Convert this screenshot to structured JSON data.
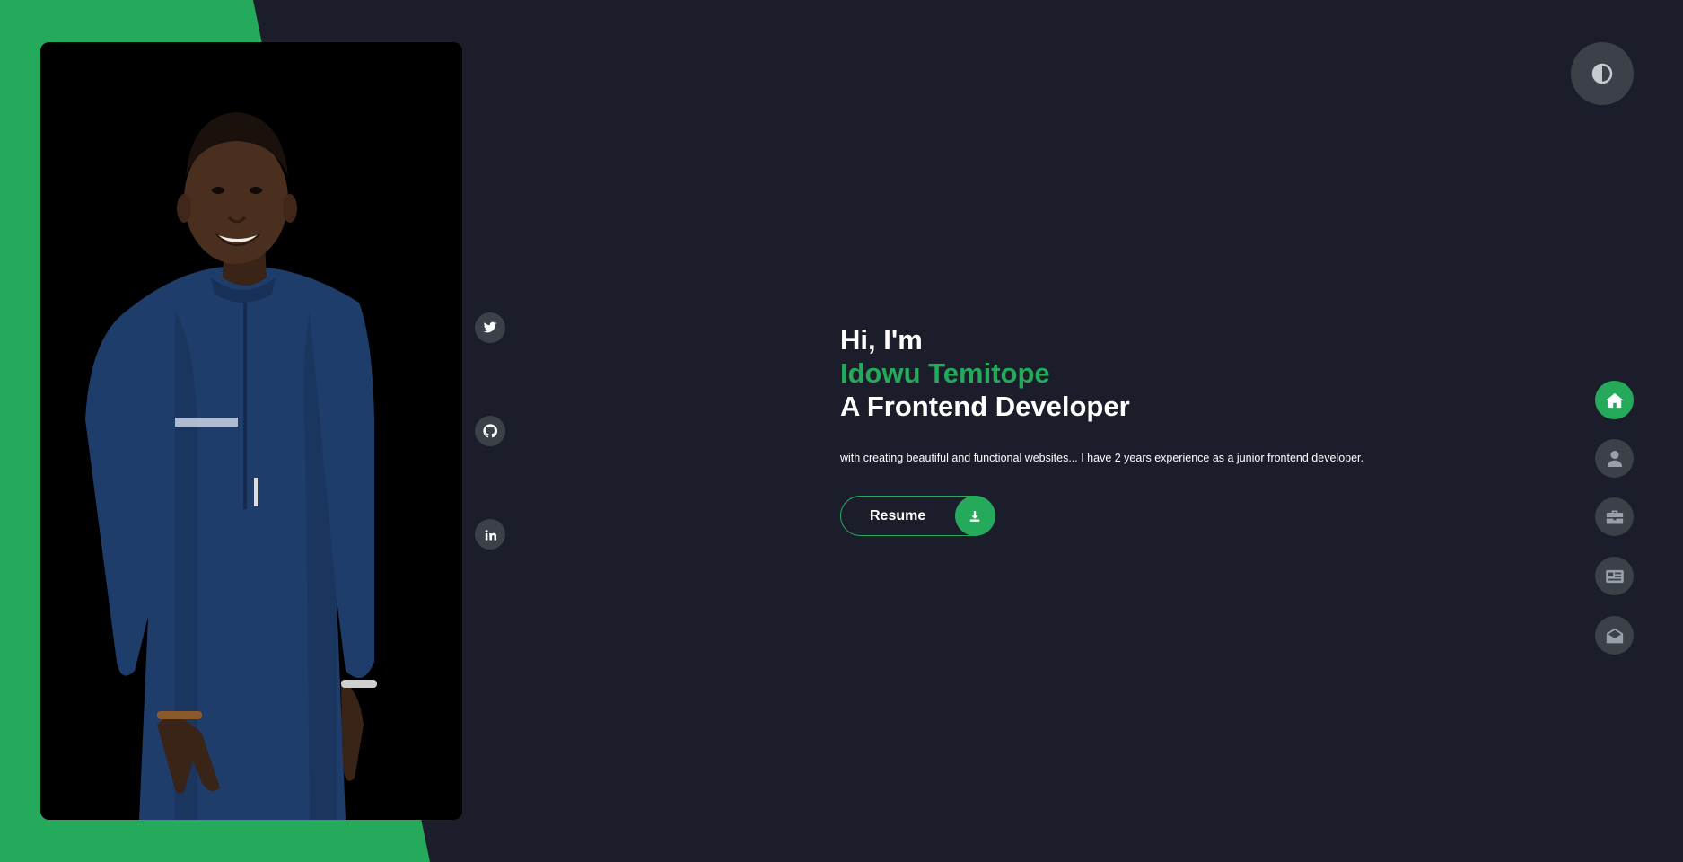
{
  "hero": {
    "greeting": "Hi, I'm",
    "name": "Idowu Temitope",
    "role": "A Frontend Developer",
    "description": "with creating beautiful and functional websites... I have 2 years experience as a junior frontend developer."
  },
  "resume": {
    "label": "Resume",
    "icon": "download-icon"
  },
  "social": [
    "twitter-icon",
    "github-icon",
    "linkedin-icon"
  ],
  "nav": [
    "home-icon",
    "user-icon",
    "briefcase-icon",
    "newspaper-icon",
    "envelope-open-icon"
  ],
  "theme_toggle": {
    "icon": "contrast-icon"
  },
  "colors": {
    "accent": "#25a95a",
    "background": "#1b1d2a",
    "button_gray": "#3b4049"
  }
}
